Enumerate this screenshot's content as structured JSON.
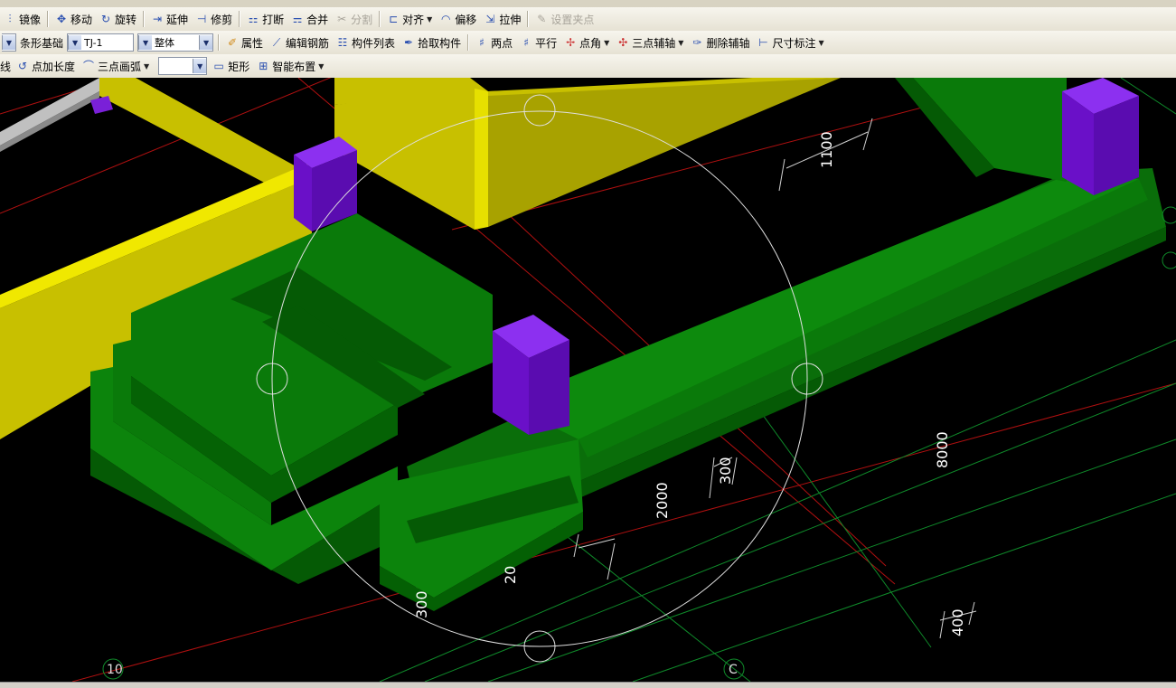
{
  "toolbar1": {
    "items": [
      {
        "label": "镜像",
        "icon": "mirror-icon"
      },
      {
        "label": "移动",
        "icon": "move-icon"
      },
      {
        "label": "旋转",
        "icon": "rotate-icon"
      },
      {
        "label": "延伸",
        "icon": "extend-icon"
      },
      {
        "label": "修剪",
        "icon": "trim-icon"
      },
      {
        "label": "打断",
        "icon": "break-icon"
      },
      {
        "label": "合并",
        "icon": "merge-icon"
      },
      {
        "label": "分割",
        "icon": "split-icon"
      },
      {
        "label": "对齐",
        "icon": "align-icon"
      },
      {
        "label": "偏移",
        "icon": "offset-icon"
      },
      {
        "label": "拉伸",
        "icon": "stretch-icon"
      },
      {
        "label": "设置夹点",
        "icon": "grip-icon"
      }
    ]
  },
  "toolbar2": {
    "type_combo": "条形基础",
    "name_combo": "TJ-1",
    "part_combo": "整体",
    "items": [
      {
        "label": "属性",
        "icon": "property-icon"
      },
      {
        "label": "编辑钢筋",
        "icon": "edit-rebar-icon"
      },
      {
        "label": "构件列表",
        "icon": "component-list-icon"
      },
      {
        "label": "拾取构件",
        "icon": "pick-component-icon"
      },
      {
        "label": "两点",
        "icon": "two-point-icon"
      },
      {
        "label": "平行",
        "icon": "parallel-icon"
      },
      {
        "label": "点角",
        "icon": "point-angle-icon"
      },
      {
        "label": "三点辅轴",
        "icon": "three-point-axis-icon"
      },
      {
        "label": "删除辅轴",
        "icon": "delete-axis-icon"
      },
      {
        "label": "尺寸标注",
        "icon": "dimension-icon"
      }
    ]
  },
  "toolbar3": {
    "left_fragment": "线",
    "items": [
      {
        "label": "点加长度",
        "icon": "point-length-icon"
      },
      {
        "label": "三点画弧",
        "icon": "arc-icon"
      },
      {
        "label": "矩形",
        "icon": "rectangle-icon"
      },
      {
        "label": "智能布置",
        "icon": "smart-layout-icon"
      }
    ]
  },
  "viewport": {
    "dimensions": {
      "d1100": "1100",
      "d8000": "8000",
      "d2000": "2000",
      "d300a": "300",
      "d300b": "300",
      "d400": "400",
      "d20": "20"
    },
    "axis_labels": {
      "axis10": "10",
      "axisC": "C"
    },
    "colors": {
      "background": "#000000",
      "footing": "#0a7a0a",
      "wall": "#c8c000",
      "column": "#6a10c8",
      "grid_red": "#b01010",
      "grid_green": "#0f8a2a",
      "grip": "#e0e0e0"
    }
  }
}
